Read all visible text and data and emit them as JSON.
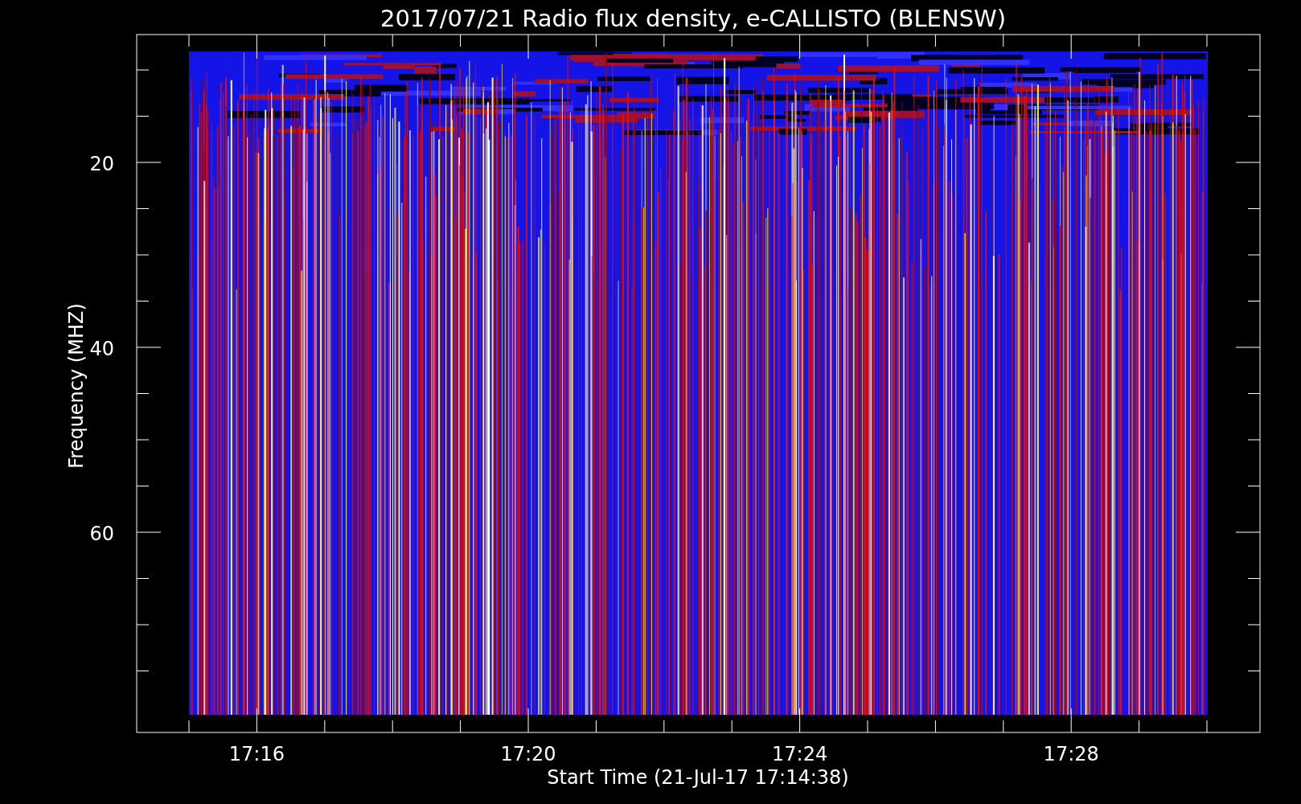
{
  "title": "2017/07/21  Radio flux density, e-CALLISTO (BLENSW)",
  "plot": {
    "ylabel": "Frequency (MHZ)",
    "xlabel": "Start Time (21-Jul-17 17:14:38)",
    "yticks": [
      "20",
      "40",
      "60"
    ],
    "xticks": [
      "17:16",
      "17:20",
      "17:24",
      "17:28"
    ]
  }
}
